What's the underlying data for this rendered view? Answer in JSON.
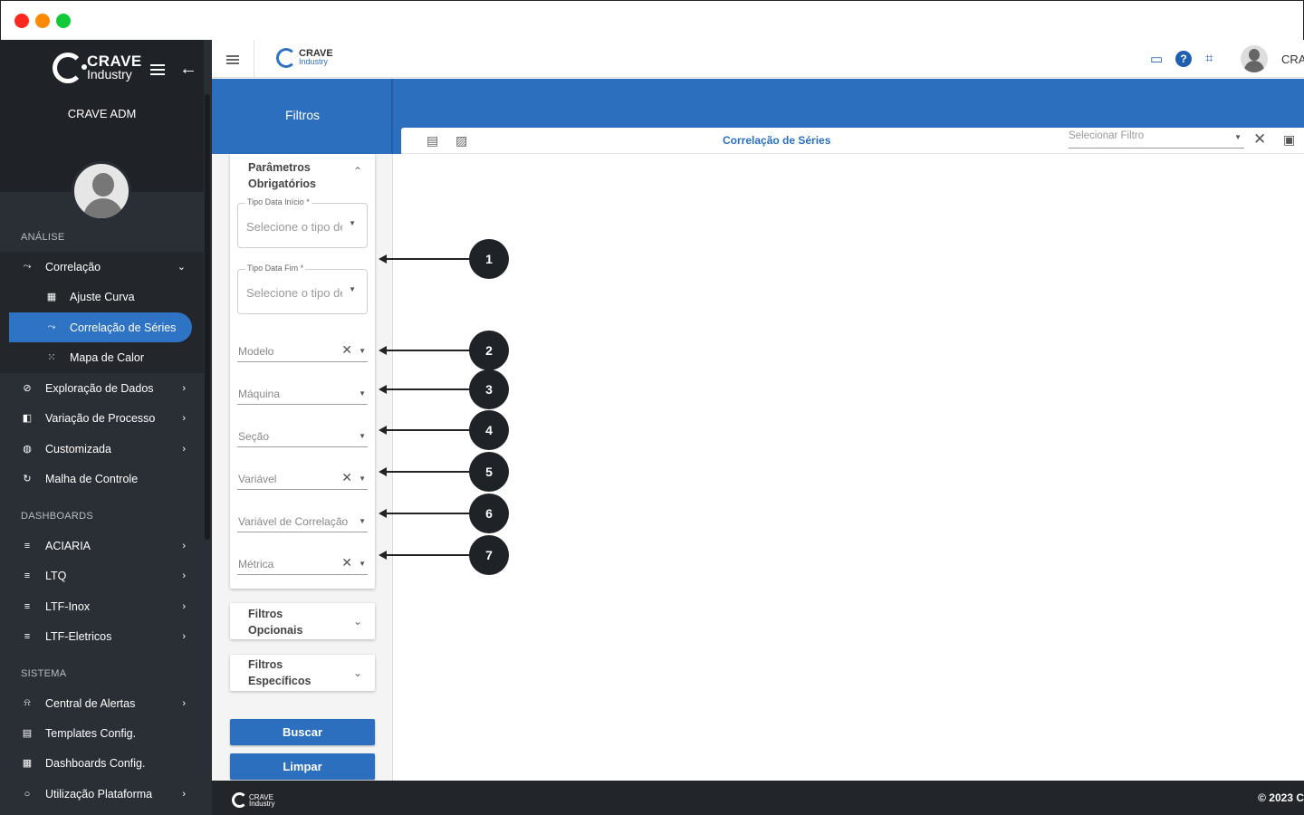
{
  "window": {
    "controls": [
      "close",
      "minimize",
      "maximize"
    ]
  },
  "brand": {
    "name": "CRAVE",
    "sub": "Industry"
  },
  "sidebar": {
    "user": "CRAVE ADM",
    "sections": {
      "analysis": "ANÁLISE",
      "dashboards": "DASHBOARDS",
      "system": "SISTEMA"
    },
    "items": {
      "correlacao": "Correlação",
      "ajuste_curva": "Ajuste Curva",
      "correlacao_series": "Correlação de Séries",
      "mapa_calor": "Mapa de Calor",
      "exploracao": "Exploração de Dados",
      "variacao": "Variação de Processo",
      "customizada": "Customizada",
      "malha": "Malha de Controle",
      "aciaria": "ACIARIA",
      "ltq": "LTQ",
      "ltf_inox": "LTF-Inox",
      "ltf_eletricos": "LTF-Eletricos",
      "central_alertas": "Central de Alertas",
      "templates": "Templates Config.",
      "dashboards_config": "Dashboards Config.",
      "utilizacao": "Utilização Plataforma"
    }
  },
  "topbar": {
    "user": "CRA"
  },
  "filters": {
    "title": "Filtros",
    "required": {
      "title_line1": "Parâmetros",
      "title_line2": "Obrigatórios",
      "tipo_inicio_label": "Tipo Data Início *",
      "tipo_inicio_placeholder": "Selecione o tipo de data",
      "tipo_fim_label": "Tipo Data Fim *",
      "tipo_fim_placeholder": "Selecione o tipo de data",
      "modelo": "Modelo",
      "maquina": "Máquina",
      "secao": "Seção",
      "variavel": "Variável",
      "variavel_correlacao": "Variável de Correlação",
      "metrica": "Métrica"
    },
    "optional": {
      "line1": "Filtros",
      "line2": "Opcionais"
    },
    "specific": {
      "line1": "Filtros",
      "line2": "Específicos"
    },
    "buttons": {
      "search": "Buscar",
      "clear": "Limpar"
    }
  },
  "content": {
    "title": "Correlação de Séries",
    "select_filter_placeholder": "Selecionar Filtro"
  },
  "annotations": [
    "1",
    "2",
    "3",
    "4",
    "5",
    "6",
    "7"
  ],
  "footer": {
    "copyright": "© 2023 C"
  },
  "colors": {
    "primary": "#2b6fbe",
    "sidebar": "#2a2e35",
    "active": "#2f73c4"
  }
}
